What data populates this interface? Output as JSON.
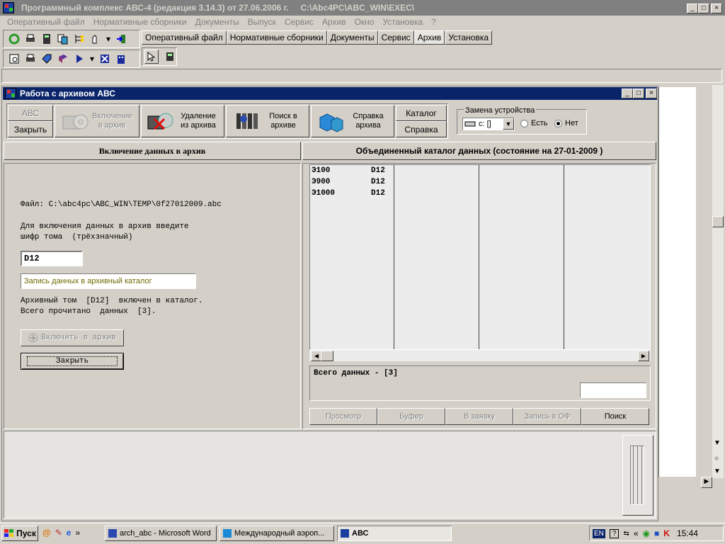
{
  "main": {
    "title": "Программный комплекс АВС-4 (редакция 3.14.3) от 27.06.2006 г.     C:\\Abc4PC\\ABC_WIN\\EXEC\\",
    "menu": [
      "Оперативный файл",
      "Нормативные сборники",
      "Документы",
      "Выпуск",
      "Сервис",
      "Архив",
      "Окно",
      "Установка",
      "?"
    ],
    "tabs": [
      "Оперативный файл",
      "Нормативные сборники",
      "Документы",
      "Сервис",
      "Архив",
      "Установка"
    ]
  },
  "archive": {
    "title": "Работа с архивом АВС",
    "toolbar": {
      "abc_label": "АВС",
      "close_label": "Закрыть",
      "include_label": "Включение в архив",
      "delete_label": "Удаление из архива",
      "search_label": "Поиск в архиве",
      "help_archive_label": "Справка архива",
      "catalog_label": "Каталог",
      "help_label": "Справка"
    },
    "device": {
      "group_label": "Замена устройства",
      "drive_value": "c: []",
      "opt_yes": "Есть",
      "opt_no": "Нет",
      "selected": "Нет"
    },
    "left": {
      "header": "Включение данных в архив",
      "file_line": "Файл: C:\\abc4pc\\ABC_WIN\\TEMP\\0f27012009.abc",
      "prompt_line1": "Для включения данных в архив введите",
      "prompt_line2": "шифр тома  (трёхзначный)",
      "volume_code": "D12",
      "status_field": "Запись данных в архивный каталог",
      "result_line1": "Архивный том  [D12]  включен в каталог.",
      "result_line2": "Всего прочитано  данных  [3].",
      "include_button": "Включить в архив",
      "close_button": "Закрыть"
    },
    "right": {
      "header": "Объединенный каталог данных (состояние на 27-01-2009 )",
      "rows": [
        {
          "code": "Э100",
          "vol": "D12"
        },
        {
          "code": "Э900",
          "vol": "D12"
        },
        {
          "code": "Э1000",
          "vol": "D12"
        }
      ],
      "total_label": "Всего данных - [3]",
      "buttons": [
        "Просмотр",
        "Буфер",
        "В заявку",
        "Запись в ОФ",
        "Поиск"
      ]
    }
  },
  "taskbar": {
    "start": "Пуск",
    "tasks": [
      "arch_abc - Microsoft Word",
      "Международный аэроп...",
      "АВС"
    ],
    "lang": "EN",
    "clock": "15:44"
  },
  "colors": {
    "title_active": "#0a246a",
    "title_inactive": "#808080",
    "desktop_face": "#d4d0c8",
    "list_bg": "#ececec"
  }
}
